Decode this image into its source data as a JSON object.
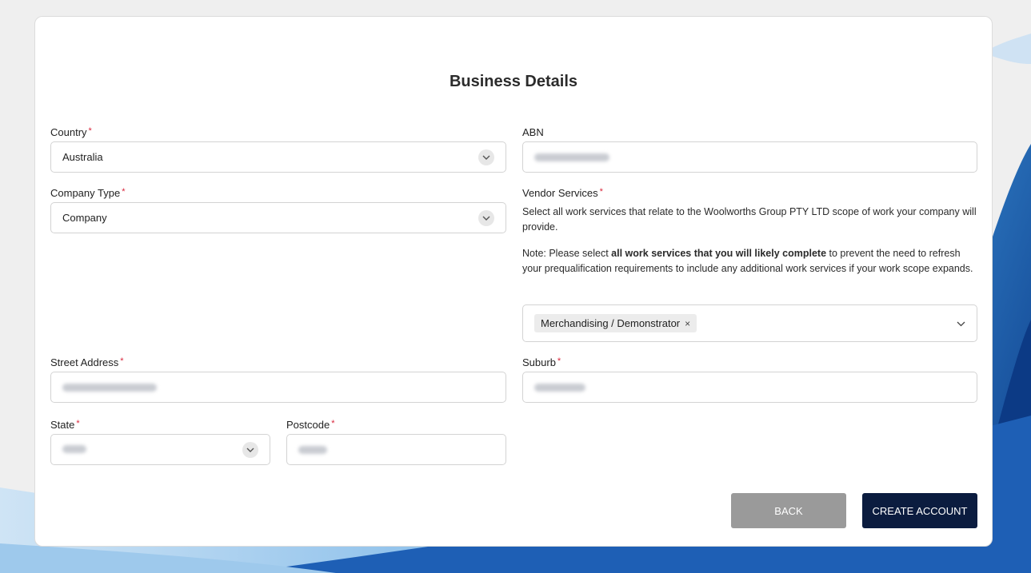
{
  "form": {
    "title": "Business Details",
    "required_mark": "*",
    "country": {
      "label": "Country",
      "value": "Australia"
    },
    "abn": {
      "label": "ABN"
    },
    "company_type": {
      "label": "Company Type",
      "value": "Company"
    },
    "vendor_services": {
      "label": "Vendor Services",
      "help": "Select all work services that relate to the Woolworths Group PTY LTD scope of work your company will provide.",
      "note_prefix": "Note: Please select ",
      "note_bold": "all work services that you will likely complete",
      "note_suffix": " to prevent the need to refresh your prequalification requirements to include any additional work services if your work scope expands.",
      "selected": [
        "Merchandising / Demonstrator"
      ],
      "remove_symbol": "×"
    },
    "street_address": {
      "label": "Street Address"
    },
    "suburb": {
      "label": "Suburb"
    },
    "state": {
      "label": "State"
    },
    "postcode": {
      "label": "Postcode"
    }
  },
  "buttons": {
    "back": "BACK",
    "create": "CREATE ACCOUNT"
  },
  "icons": {
    "country_dropdown": "chevron-down-icon",
    "company_type_dropdown": "chevron-down-icon",
    "state_dropdown": "chevron-down-icon",
    "vendor_dropdown": "chevron-down-icon",
    "chip_remove": "close-icon"
  },
  "colors": {
    "primary_button": "#0b1c3f",
    "back_button": "#9a9a9a",
    "required": "#d9263b"
  }
}
